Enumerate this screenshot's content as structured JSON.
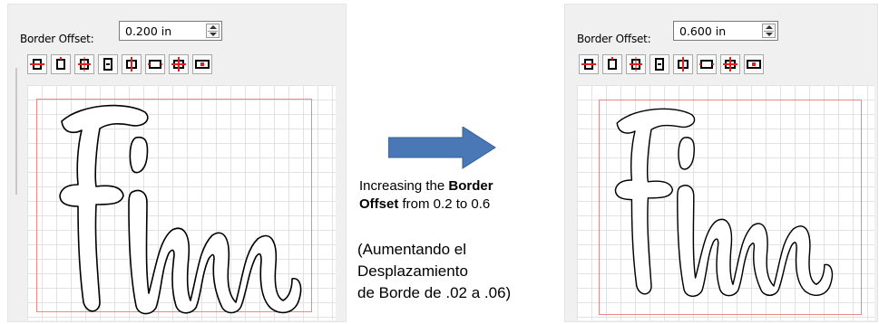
{
  "left_panel": {
    "border_offset_label": "Border Offset:",
    "border_offset_value": "0.200 in"
  },
  "right_panel": {
    "border_offset_label": "Border Offset:",
    "border_offset_value": "0.600 in"
  },
  "toolbar_icons": [
    "align-left-icon",
    "align-center-horizontal-icon",
    "align-right-icon",
    "align-top-icon",
    "align-middle-vertical-icon",
    "align-bottom-icon",
    "center-both-icon",
    "distribute-icon"
  ],
  "design_text": "Finn",
  "caption": {
    "line1_prefix": "Increasing the ",
    "line1_bold": "Border",
    "line2_bold": "Offset",
    "line2_suffix": " from 0.2  to 0.6"
  },
  "spanish_caption": {
    "line1": "(Aumentando el",
    "line2": "Desplazamiento",
    "line3": "de Borde de .02 a .06)"
  },
  "colors": {
    "arrow_fill": "#4a77b6",
    "mat_border": "#e98a8a",
    "align_red": "#e02020"
  }
}
